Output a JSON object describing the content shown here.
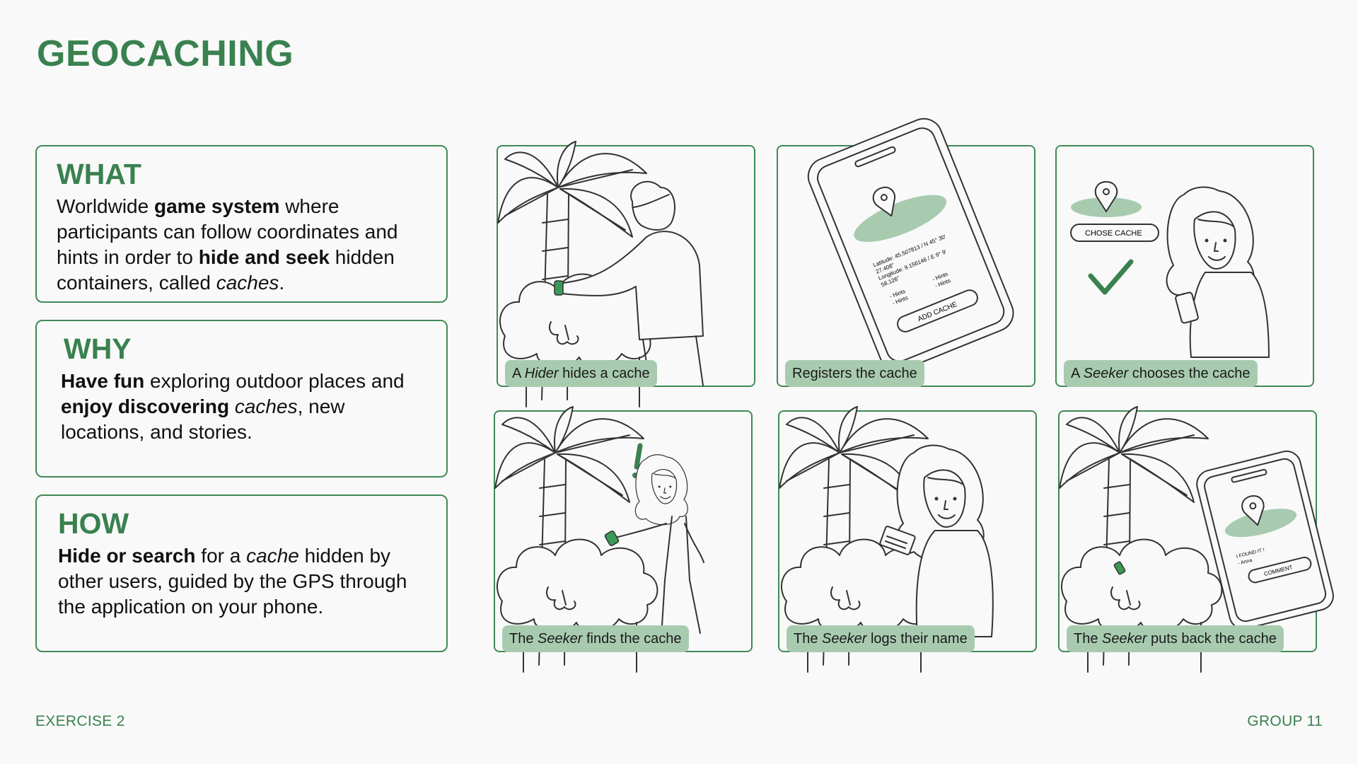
{
  "title": "GEOCACHING",
  "cards": {
    "what": {
      "heading": "WHAT",
      "t1": "Worldwide ",
      "b1": "game system",
      "t2": " where participants can follow coordinates and hints in order to ",
      "b2": "hide and seek",
      "t3": " hidden containers, called ",
      "i1": "caches",
      "t4": "."
    },
    "why": {
      "heading": "WHY",
      "b1": "Have fun",
      "t1": " exploring outdoor places and ",
      "b2": "enjoy discovering",
      "t2": " ",
      "i1": "caches",
      "t3": ", new locations, and stories."
    },
    "how": {
      "heading": "HOW",
      "b1": "Hide or search",
      "t1": " for a ",
      "i1": "cache",
      "t2": " hidden by other users, guided by the GPS through the application on your phone."
    }
  },
  "panels": [
    {
      "pre": "A ",
      "em": "Hider",
      "post": " hides a cache"
    },
    {
      "pre": "Registers the cache",
      "em": "",
      "post": ""
    },
    {
      "pre": "A ",
      "em": "Seeker",
      "post": " chooses the cache"
    },
    {
      "pre": "The ",
      "em": "Seeker",
      "post": " finds the cache"
    },
    {
      "pre": "The ",
      "em": "Seeker",
      "post": " logs their name"
    },
    {
      "pre": "The ",
      "em": "Seeker",
      "post": " puts back the cache"
    }
  ],
  "phone_texts": {
    "add_cache": "ADD CACHE",
    "coords_lat": "Latitude: 45.507813 / N 45° 30'",
    "coords_lat2": "27.408\"",
    "coords_lon": "Longitude: 9.156146 / E 9° 9'",
    "coords_lon2": "58.126\"",
    "hints1": "- Hints",
    "hints2": "- Hints",
    "hints3": "- Hints",
    "hints4": "- Hints",
    "chose_cache": "CHOSE CACHE",
    "found_it": "I FOUND IT !",
    "anna": "- Anna",
    "comment": "COMMENT"
  },
  "footer": {
    "left": "EXERCISE 2",
    "right": "GROUP 11"
  },
  "colors": {
    "accent": "#3a8150",
    "caption_bg": "#a8cbb0",
    "border": "#3f8a55"
  }
}
